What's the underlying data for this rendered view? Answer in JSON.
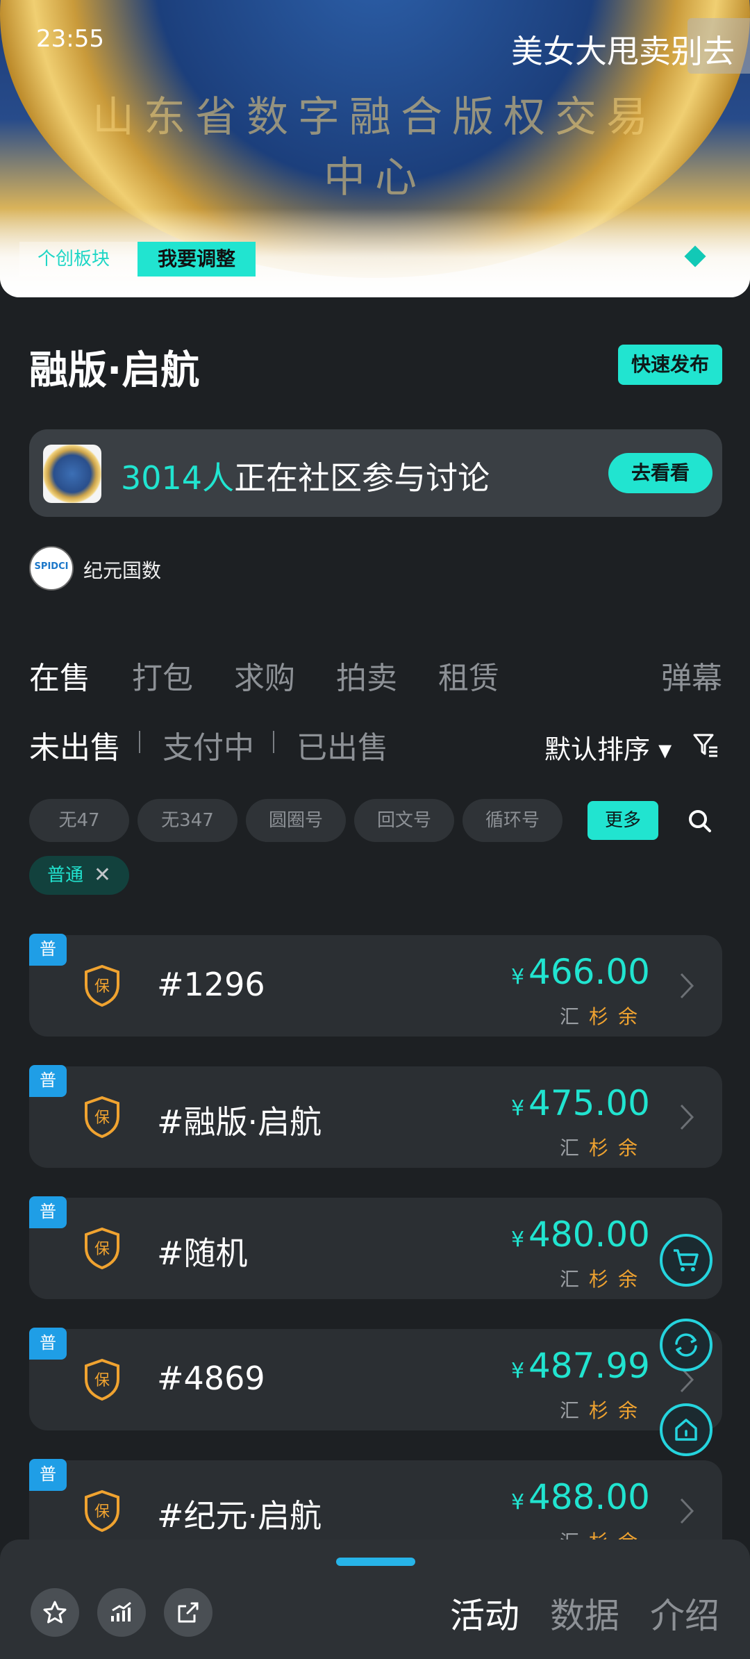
{
  "status": {
    "time": "23:55"
  },
  "hero": {
    "marquee": "美女大甩卖别去",
    "coin_text": "山东省数字融合版权交易中心",
    "tag_label": "个创板块",
    "tag_button": "我要调整"
  },
  "header": {
    "title": "融版·启航",
    "publish_button": "快速发布"
  },
  "community": {
    "count": "3014人",
    "text": "正在社区参与讨论",
    "button": "去看看"
  },
  "brand": {
    "logo_text": "SPIDCI",
    "name": "纪元国数"
  },
  "tabs": [
    "在售",
    "打包",
    "求购",
    "拍卖",
    "租赁"
  ],
  "danmu_label": "弹幕",
  "subtabs": [
    "未出售",
    "支付中",
    "已出售"
  ],
  "sort_label": "默认排序 ▾",
  "chips": [
    "无47",
    "无347",
    "圆圈号",
    "回文号",
    "循环号"
  ],
  "chip_more": "更多",
  "active_filter": "普通",
  "listings": [
    {
      "badge": "普",
      "name": "#1296",
      "currency": "¥",
      "price": "466.00",
      "tags": [
        "汇",
        "杉",
        "余"
      ]
    },
    {
      "badge": "普",
      "name": "#融版·启航",
      "currency": "¥",
      "price": "475.00",
      "tags": [
        "汇",
        "杉",
        "余"
      ]
    },
    {
      "badge": "普",
      "name": "#随机",
      "currency": "¥",
      "price": "480.00",
      "tags": [
        "汇",
        "杉",
        "余"
      ]
    },
    {
      "badge": "普",
      "name": "#4869",
      "currency": "¥",
      "price": "487.99",
      "tags": [
        "汇",
        "杉",
        "余"
      ]
    },
    {
      "badge": "普",
      "name": "#纪元·启航",
      "currency": "¥",
      "price": "488.00",
      "tags": [
        "汇",
        "杉",
        "余"
      ]
    }
  ],
  "shield_glyph": "保",
  "bottom_tabs": [
    "活动",
    "数据",
    "介绍"
  ],
  "colors": {
    "accent": "#21e4d0",
    "background": "#1d2023",
    "card": "#2b2f33",
    "tag_orange": "#f0a330",
    "badge_blue": "#1f9ee6"
  },
  "icons": {
    "floating": [
      "cart-icon",
      "refresh-icon",
      "home-icon"
    ],
    "bottom_actions": [
      "star-icon",
      "chart-icon",
      "share-icon"
    ]
  }
}
